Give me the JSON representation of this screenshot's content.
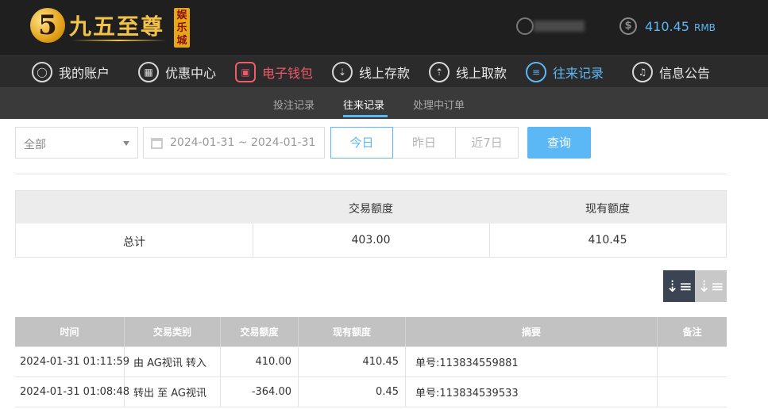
{
  "brand": {
    "logo_digit": "5",
    "name": "九五至尊",
    "badge": "娱乐城"
  },
  "account": {
    "balance": "410.45",
    "currency": "RMB"
  },
  "main_nav": [
    {
      "label": "我的账户",
      "icon": "user-icon"
    },
    {
      "label": "优惠中心",
      "icon": "gift-icon"
    },
    {
      "label": "电子钱包",
      "icon": "wallet-icon"
    },
    {
      "label": "线上存款",
      "icon": "deposit-icon"
    },
    {
      "label": "线上取款",
      "icon": "withdraw-icon"
    },
    {
      "label": "往来记录",
      "icon": "records-icon"
    },
    {
      "label": "信息公告",
      "icon": "bell-icon"
    }
  ],
  "sub_nav": [
    {
      "label": "投注记录"
    },
    {
      "label": "往来记录"
    },
    {
      "label": "处理中订单"
    }
  ],
  "filters": {
    "type_select": "全部",
    "date_range": "2024-01-31 ~ 2024-01-31",
    "quick_ranges": [
      "今日",
      "昨日",
      "近7日"
    ],
    "search_label": "查询"
  },
  "summary": {
    "headers": [
      "交易额度",
      "现有额度"
    ],
    "row_label": "总计",
    "trade_total": "403.00",
    "current_total": "410.45"
  },
  "table": {
    "headers": [
      "时间",
      "交易类别",
      "交易额度",
      "现有额度",
      "摘要",
      "备注"
    ],
    "rows": [
      {
        "time": "2024-01-31 01:11:59",
        "type": "由 AG视讯 转入",
        "amount": "410.00",
        "balance": "410.45",
        "summary": "单号:113834559881",
        "note": ""
      },
      {
        "time": "2024-01-31 01:08:48",
        "type": "转出 至 AG视讯",
        "amount": "-364.00",
        "balance": "0.45",
        "summary": "单号:113834539533",
        "note": ""
      }
    ]
  },
  "colors": {
    "accent": "#5bb8f5",
    "wallet_red": "#f05a6a",
    "gold": "#f3c24a"
  }
}
